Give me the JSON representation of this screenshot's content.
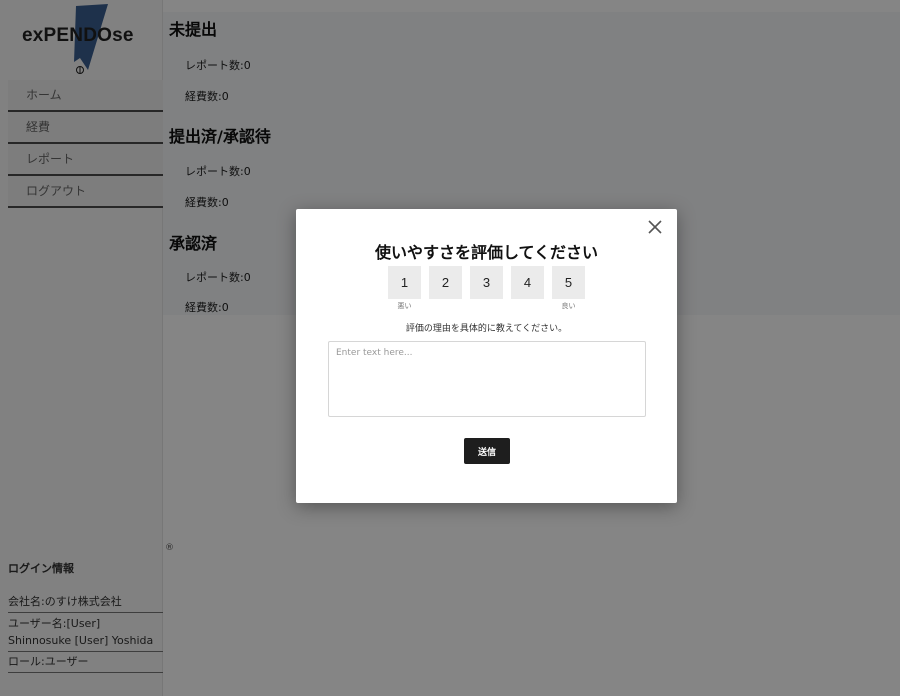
{
  "app": {
    "logo_text": "exPENDOse"
  },
  "sidebar": {
    "nav": [
      {
        "label": "ホーム"
      },
      {
        "label": "経費"
      },
      {
        "label": "レポート"
      },
      {
        "label": "ログアウト"
      }
    ],
    "login_info": {
      "title": "ログイン情報",
      "company": "会社名:のすけ株式会社",
      "user": "ユーザー名:[User] Shinnosuke [User] Yoshida",
      "role": "ロール:ユーザー"
    },
    "reg_mark": "®"
  },
  "main": {
    "sections": [
      {
        "title": "未提出",
        "report_count": "レポート数:0",
        "expense_count": "経費数:0"
      },
      {
        "title": "提出済/承認待",
        "report_count": "レポート数:0",
        "expense_count": "経費数:0"
      },
      {
        "title": "承認済",
        "report_count": "レポート数:0",
        "expense_count": "経費数:0"
      }
    ]
  },
  "modal": {
    "title": "使いやすさを評価してください",
    "ratings": [
      "1",
      "2",
      "3",
      "4",
      "5"
    ],
    "low_caption": "悪い",
    "high_caption": "良い",
    "reason_label": "評価の理由を具体的に教えてください。",
    "textarea_placeholder": "Enter text here...",
    "submit_label": "送信",
    "close_icon": "close-icon"
  },
  "colors": {
    "overlay": "#000000",
    "main_bg": "#f5f8fa",
    "nav_divider": "#4c4c4c",
    "submit_bg": "#1e1e1e",
    "rating_bg": "#ebebeb",
    "logo_shape": "#3a5f90"
  }
}
